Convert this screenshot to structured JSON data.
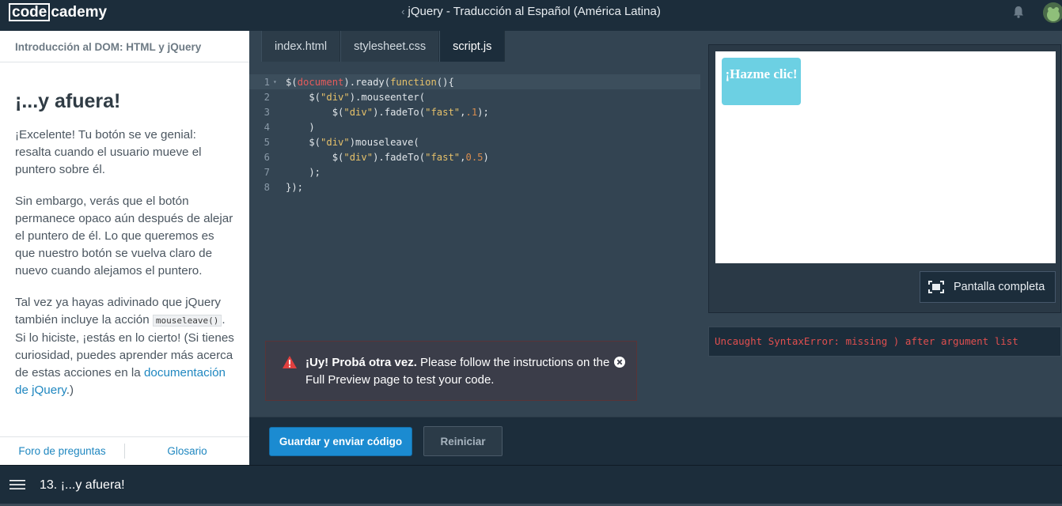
{
  "header": {
    "logo_part1": "code",
    "logo_part2": "cademy",
    "breadcrumb_chevron": "‹",
    "breadcrumb": "jQuery - Traducción al Español (América Latina)"
  },
  "left_panel": {
    "course_title": "Introducción al DOM: HTML y jQuery",
    "lesson_title": "¡...y afuera!",
    "paragraph1": "¡Excelente! Tu botón se ve genial: resalta cuando el usuario mueve el puntero sobre él.",
    "paragraph2": "Sin embargo, verás que el botón permanece opaco aún después de alejar el puntero de él. Lo que queremos es que nuestro botón se vuelva claro de nuevo cuando alejamos el puntero.",
    "paragraph3_a": "Tal vez ya hayas adivinado que jQuery también incluye la acción ",
    "paragraph3_code": "mouseleave()",
    "paragraph3_b": ". Si lo hiciste, ¡estás en lo cierto! (Si tienes curiosidad, puedes aprender más acerca de estas acciones en la ",
    "paragraph3_link": "documentación de jQuery",
    "paragraph3_c": ".)",
    "footer_forum": "Foro de preguntas",
    "footer_glossary": "Glosario"
  },
  "tabs": [
    {
      "label": "index.html",
      "active": false
    },
    {
      "label": "stylesheet.css",
      "active": false
    },
    {
      "label": "script.js",
      "active": true
    }
  ],
  "code_lines": [
    "$(document).ready(function(){",
    "    $(\"div\").mouseenter(",
    "        $(\"div\").fadeTo(\"fast\",.1);",
    "    )",
    "    $(\"div\")mouseleave(",
    "        $(\"div\").fadeTo(\"fast\",0.5)",
    "    );",
    "});"
  ],
  "line_numbers": [
    "1",
    "2",
    "3",
    "4",
    "5",
    "6",
    "7",
    "8"
  ],
  "preview": {
    "button_label": "¡Hazme clic!",
    "fullscreen_label": "Pantalla completa"
  },
  "console_error": "Uncaught SyntaxError: missing ) after argument list",
  "error_banner": {
    "bold": "¡Uy! Probá otra vez.",
    "message": " Please follow the instructions on the Full Preview page to test your code."
  },
  "actions": {
    "submit_label": "Guardar y enviar código",
    "reset_label": "Reiniciar"
  },
  "bottom_bar": {
    "lesson_nav": "13. ¡...y afuera!"
  },
  "colors": {
    "dark_bg": "#1c2d3b",
    "editor_bg": "#334452",
    "accent_blue": "#1b8bd1",
    "error_red": "#e04f4f",
    "preview_button": "#6cd0e3"
  },
  "icons": [
    "bell-icon",
    "avatar",
    "warning-icon",
    "close-icon",
    "fullscreen-icon",
    "menu-icon"
  ]
}
